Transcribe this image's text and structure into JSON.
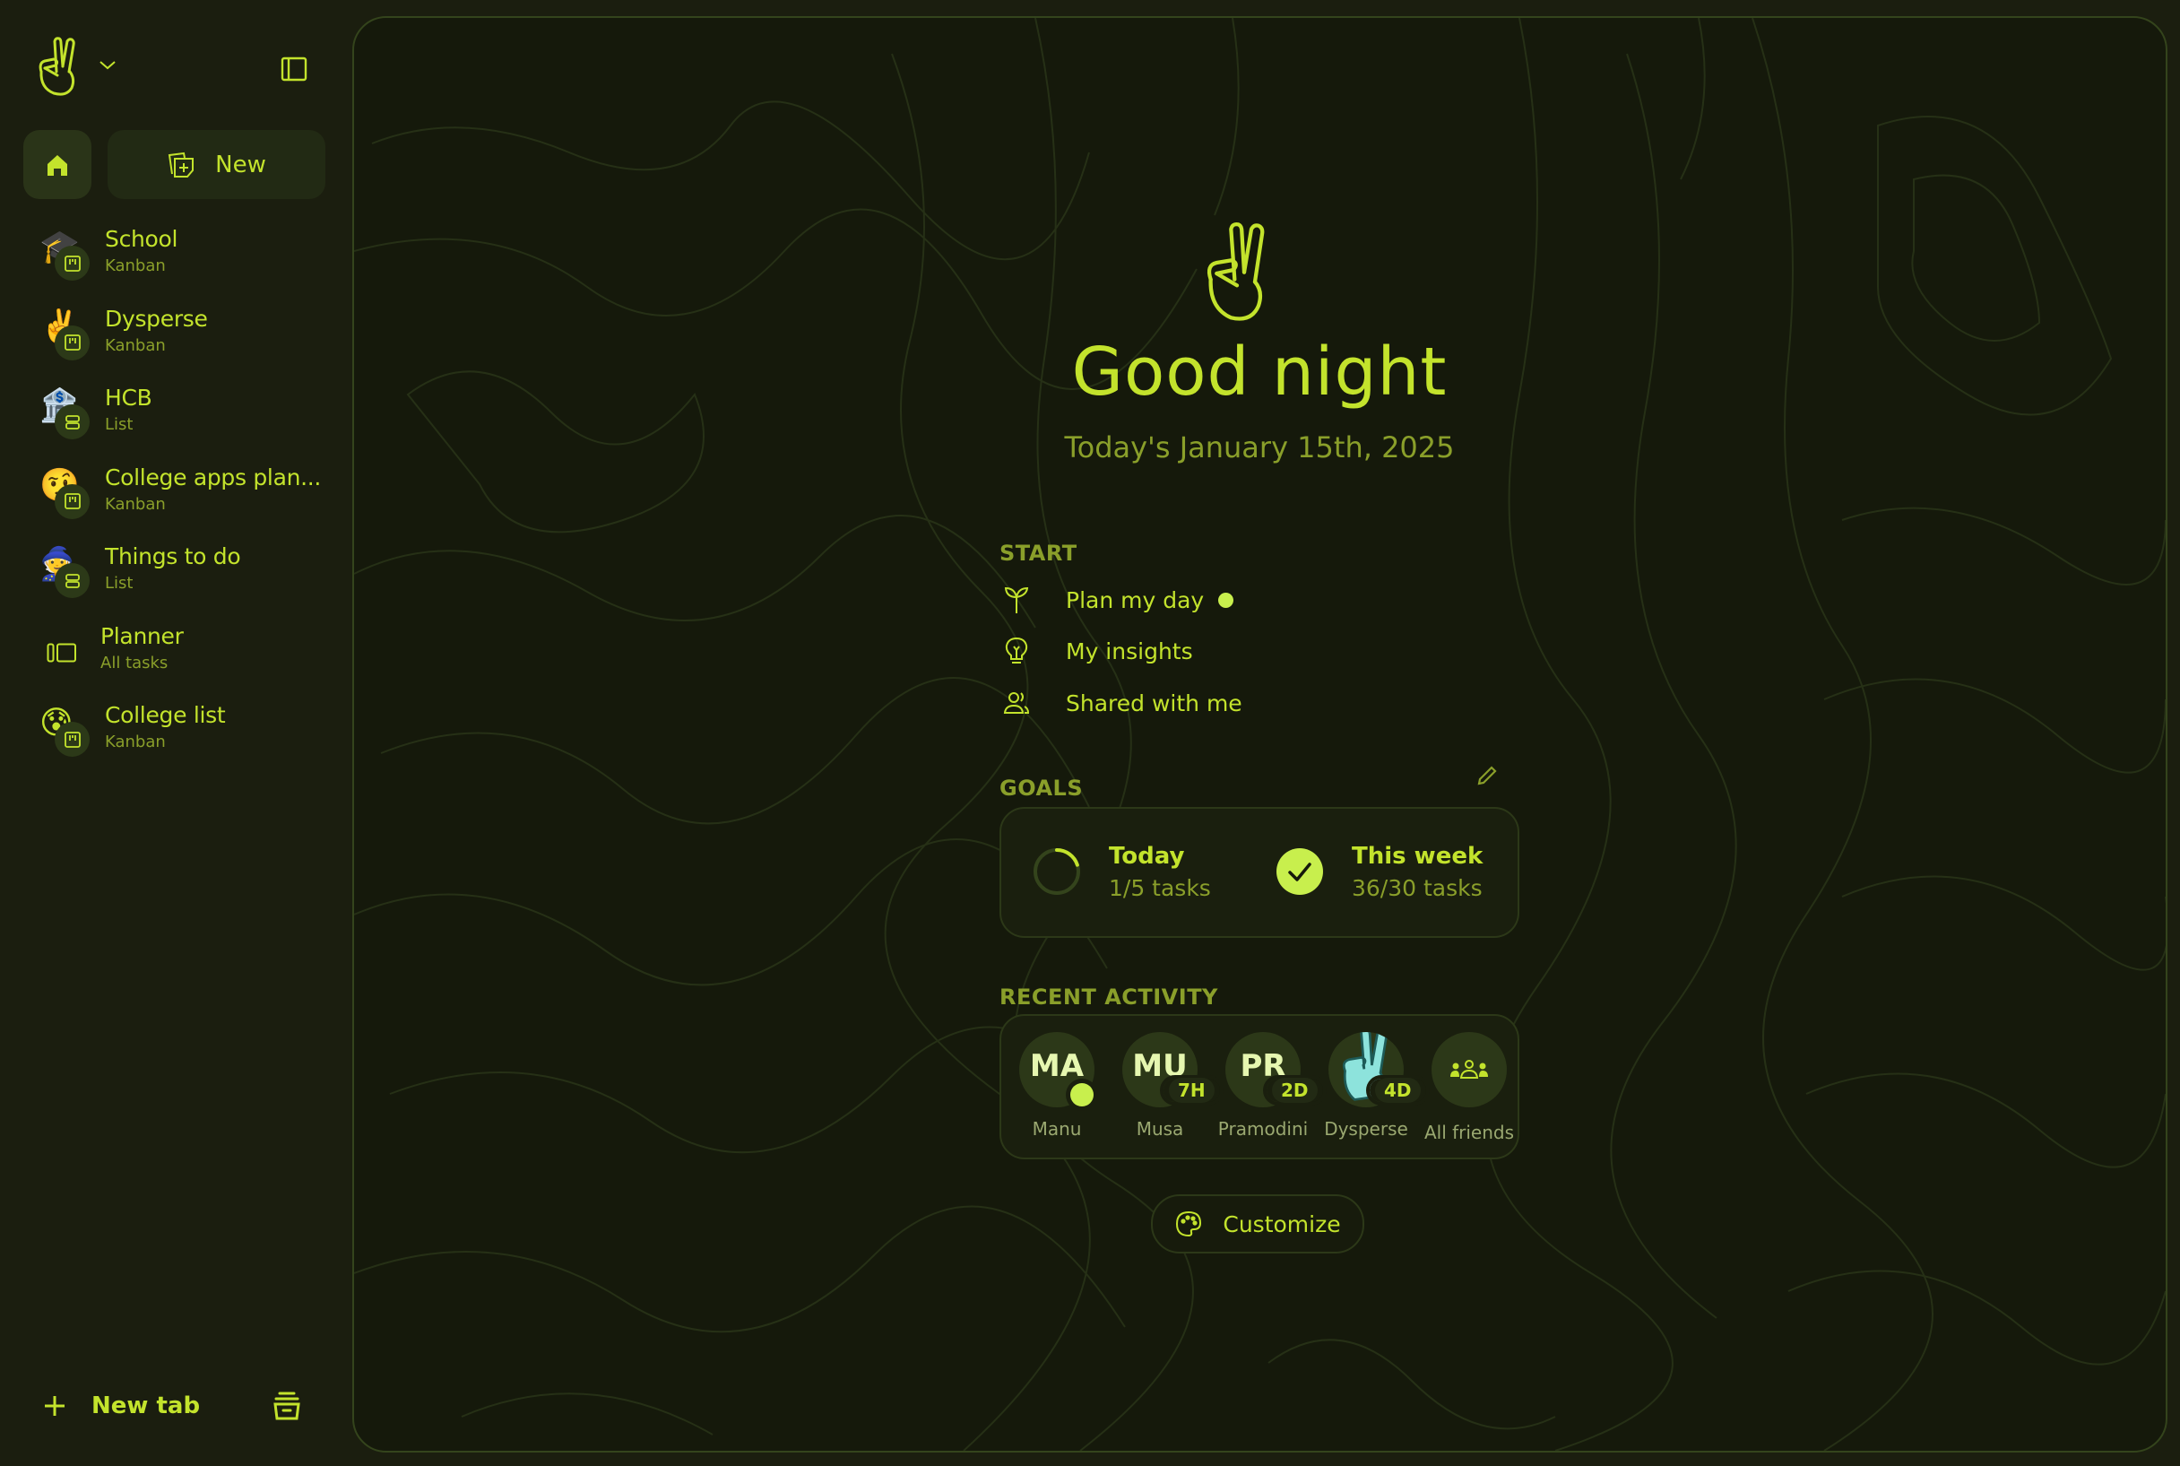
{
  "colors": {
    "accent": "#c3e32c",
    "accent_muted": "#8a9f2a",
    "background": "#1b1e0f",
    "panel": "#15190b",
    "panel_border": "#34441c",
    "friend_avatar_bg": "#2c3818",
    "dysperse_avatar": "#8de3dc"
  },
  "sidebar": {
    "logo_icon": "peace-hand-icon",
    "new_button_label": "New",
    "tabs": [
      {
        "title": "School",
        "subtitle": "Kanban",
        "emoji": "🎓",
        "type_icon": "kanban-icon"
      },
      {
        "title": "Dysperse",
        "subtitle": "Kanban",
        "emoji": "✌️",
        "type_icon": "kanban-icon"
      },
      {
        "title": "HCB",
        "subtitle": "List",
        "emoji": "🏦",
        "type_icon": "list-icon"
      },
      {
        "title": "College apps plan...",
        "subtitle": "Kanban",
        "emoji": "🤨",
        "type_icon": "kanban-icon"
      },
      {
        "title": "Things to do",
        "subtitle": "List",
        "emoji": "🧙",
        "type_icon": "list-icon"
      },
      {
        "title": "Planner",
        "subtitle": "All tasks",
        "emoji": "",
        "type_icon": "planner-icon"
      },
      {
        "title": "College list",
        "subtitle": "Kanban",
        "emoji": "😰",
        "type_icon": "kanban-icon"
      }
    ],
    "new_tab_label": "New tab"
  },
  "main": {
    "greeting": "Good night",
    "date": "Today's January 15th, 2025",
    "start": {
      "label": "START",
      "items": [
        {
          "label": "Plan my day",
          "icon": "sprout-icon",
          "has_dot": true
        },
        {
          "label": "My insights",
          "icon": "lightbulb-icon",
          "has_dot": false
        },
        {
          "label": "Shared with me",
          "icon": "people-icon",
          "has_dot": false
        }
      ]
    },
    "goals": {
      "label": "GOALS",
      "items": [
        {
          "title": "Today",
          "subtitle": "1/5 tasks",
          "completed": 1,
          "target": 5,
          "done": false
        },
        {
          "title": "This week",
          "subtitle": "36/30 tasks",
          "completed": 36,
          "target": 30,
          "done": true
        }
      ]
    },
    "recent_activity": {
      "label": "RECENT ACTIVITY",
      "friends": [
        {
          "initials": "MA",
          "name": "Manu",
          "badge": "",
          "online": true
        },
        {
          "initials": "MU",
          "name": "Musa",
          "badge": "7H",
          "online": false
        },
        {
          "initials": "PR",
          "name": "Pramodini",
          "badge": "2D",
          "online": false
        },
        {
          "initials": "",
          "name": "Dysperse",
          "badge": "4D",
          "online": false,
          "avatar_icon": "peace-hand-icon"
        },
        {
          "initials": "",
          "name": "All friends",
          "badge": "",
          "online": false,
          "avatar_icon": "group-icon"
        }
      ]
    },
    "customize_label": "Customize"
  }
}
